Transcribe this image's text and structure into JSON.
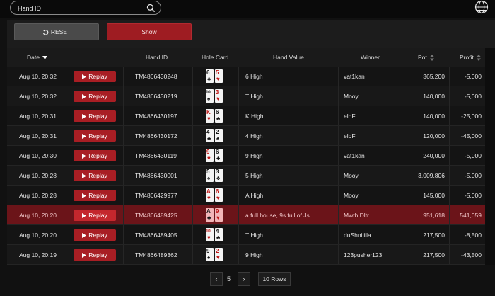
{
  "search": {
    "placeholder": "Hand ID",
    "value": ""
  },
  "toolbar": {
    "reset_label": "RESET",
    "show_label": "Show"
  },
  "columns": {
    "date": "Date",
    "hand_id": "Hand ID",
    "hole_card": "Hole Card",
    "hand_value": "Hand Value",
    "winner": "Winner",
    "pot": "Pot",
    "profit": "Profit"
  },
  "replay_label": "Replay",
  "rows": [
    {
      "date": "Aug 10, 20:32",
      "hand_id": "TM4866430248",
      "cards": [
        {
          "rank": "6",
          "suit": "♣",
          "color": "black"
        },
        {
          "rank": "5",
          "suit": "♥",
          "color": "red"
        }
      ],
      "hand_value": "6 High",
      "winner": "vat1kan",
      "pot": "365,200",
      "profit": "-5,000"
    },
    {
      "date": "Aug 10, 20:32",
      "hand_id": "TM4866430219",
      "cards": [
        {
          "rank": "10",
          "suit": "♠",
          "color": "black"
        },
        {
          "rank": "3",
          "suit": "♥",
          "color": "red"
        }
      ],
      "hand_value": "T High",
      "winner": "Mooy",
      "pot": "140,000",
      "profit": "-5,000"
    },
    {
      "date": "Aug 10, 20:31",
      "hand_id": "TM4866430197",
      "cards": [
        {
          "rank": "K",
          "suit": "♥",
          "color": "red"
        },
        {
          "rank": "6",
          "suit": "♣",
          "color": "black"
        }
      ],
      "hand_value": "K High",
      "winner": "eloF",
      "pot": "140,000",
      "profit": "-25,000"
    },
    {
      "date": "Aug 10, 20:31",
      "hand_id": "TM4866430172",
      "cards": [
        {
          "rank": "4",
          "suit": "♣",
          "color": "black"
        },
        {
          "rank": "2",
          "suit": "♠",
          "color": "black"
        }
      ],
      "hand_value": "4 High",
      "winner": "eloF",
      "pot": "120,000",
      "profit": "-45,000"
    },
    {
      "date": "Aug 10, 20:30",
      "hand_id": "TM4866430119",
      "cards": [
        {
          "rank": "9",
          "suit": "♥",
          "color": "red"
        },
        {
          "rank": "6",
          "suit": "♣",
          "color": "black"
        }
      ],
      "hand_value": "9 High",
      "winner": "vat1kan",
      "pot": "240,000",
      "profit": "-5,000"
    },
    {
      "date": "Aug 10, 20:28",
      "hand_id": "TM4866430001",
      "cards": [
        {
          "rank": "5",
          "suit": "♠",
          "color": "black"
        },
        {
          "rank": "3",
          "suit": "♣",
          "color": "black"
        }
      ],
      "hand_value": "5 High",
      "winner": "Mooy",
      "pot": "3,009,806",
      "profit": "-5,000"
    },
    {
      "date": "Aug 10, 20:28",
      "hand_id": "TM4866429977",
      "cards": [
        {
          "rank": "A",
          "suit": "♥",
          "color": "red"
        },
        {
          "rank": "6",
          "suit": "♥",
          "color": "red"
        }
      ],
      "hand_value": "A High",
      "winner": "Mooy",
      "pot": "145,000",
      "profit": "-5,000"
    },
    {
      "date": "Aug 10, 20:20",
      "hand_id": "TM4866489425",
      "cards": [
        {
          "rank": "A",
          "suit": "♣",
          "color": "black"
        },
        {
          "rank": "9",
          "suit": "♥",
          "color": "red"
        }
      ],
      "hand_value": "a full house, 9s full of Js",
      "winner": "Mwtb Dltr",
      "pot": "951,618",
      "profit": "541,059",
      "highlight": true
    },
    {
      "date": "Aug 10, 20:20",
      "hand_id": "TM4866489405",
      "cards": [
        {
          "rank": "10",
          "suit": "♥",
          "color": "red"
        },
        {
          "rank": "4",
          "suit": "♣",
          "color": "black"
        }
      ],
      "hand_value": "T High",
      "winner": "duShniiiila",
      "pot": "217,500",
      "profit": "-8,500"
    },
    {
      "date": "Aug 10, 20:19",
      "hand_id": "TM4866489362",
      "cards": [
        {
          "rank": "9",
          "suit": "♠",
          "color": "black"
        },
        {
          "rank": "2",
          "suit": "♥",
          "color": "red"
        }
      ],
      "hand_value": "9 High",
      "winner": "123pusher123",
      "pot": "217,500",
      "profit": "-43,500"
    }
  ],
  "pagination": {
    "prev": "‹",
    "page": "5",
    "next": "›",
    "rows_label": "10 Rows"
  },
  "colors": {
    "accent": "#a81e24",
    "highlight_row": "#6b1419",
    "background": "#111111"
  },
  "icons": {
    "search": "search-icon",
    "globe": "globe-icon",
    "reset": "reset-icon",
    "play": "play-icon",
    "sort": "sort-icon"
  }
}
